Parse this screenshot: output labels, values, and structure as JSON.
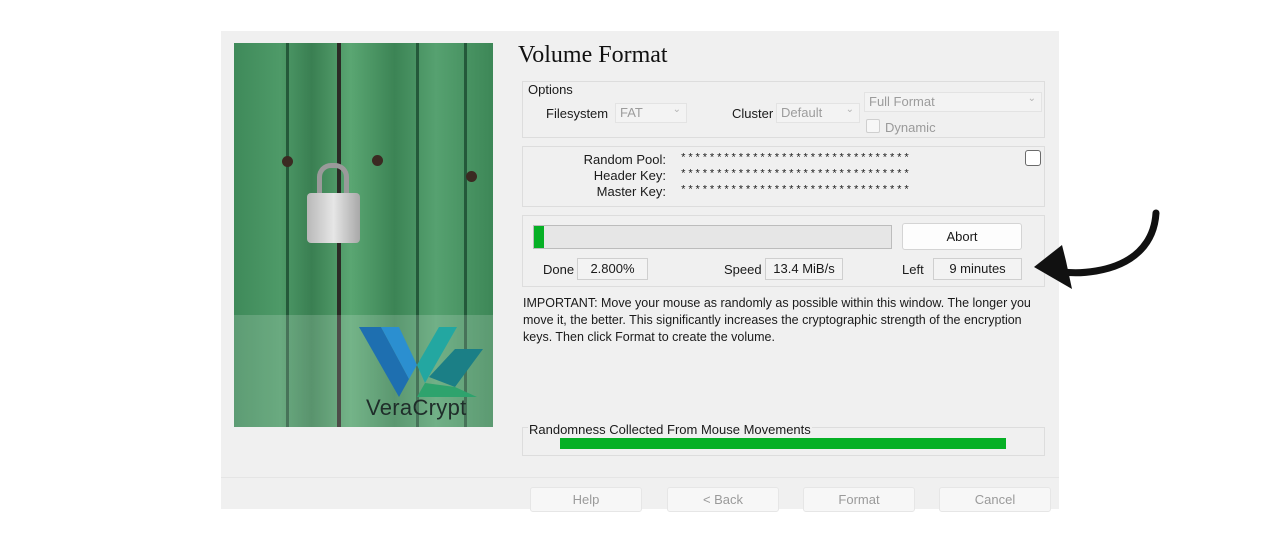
{
  "brand": {
    "name": "VeraCrypt",
    "colors": {
      "accent_blue": "#1e6fb0",
      "accent_teal": "#23a7a1",
      "progress_green": "#06b025"
    }
  },
  "page": {
    "title": "Volume Format"
  },
  "options": {
    "group_label": "Options",
    "filesystem_label": "Filesystem",
    "filesystem_value": "FAT",
    "cluster_label": "Cluster",
    "cluster_value": "Default",
    "format_mode_value": "Full Format",
    "dynamic_label": "Dynamic",
    "dynamic_checked": false
  },
  "keys": {
    "random_pool_label": "Random Pool:",
    "random_pool_value": "********************************",
    "header_key_label": "Header Key:",
    "header_key_value": "********************************",
    "master_key_label": "Master Key:",
    "master_key_value": "********************************",
    "show_keys_checked": false
  },
  "progress": {
    "fraction": 0.028,
    "abort_label": "Abort",
    "done_label": "Done",
    "done_value": "2.800%",
    "speed_label": "Speed",
    "speed_value": "13.4 MiB/s",
    "left_label": "Left",
    "left_value": "9 minutes"
  },
  "info_text": "IMPORTANT: Move your mouse as randomly as possible within this window. The longer you move it, the better. This significantly increases the cryptographic strength of the encryption keys. Then click Format to create the volume.",
  "randomness": {
    "label": "Randomness Collected From Mouse Movements",
    "fraction": 1.0
  },
  "footer": {
    "help_label": "Help",
    "back_label": "< Back",
    "format_label": "Format",
    "cancel_label": "Cancel"
  },
  "icons": {
    "annotation": "curved-arrow-icon",
    "dropdown": "chevron-down-icon"
  }
}
